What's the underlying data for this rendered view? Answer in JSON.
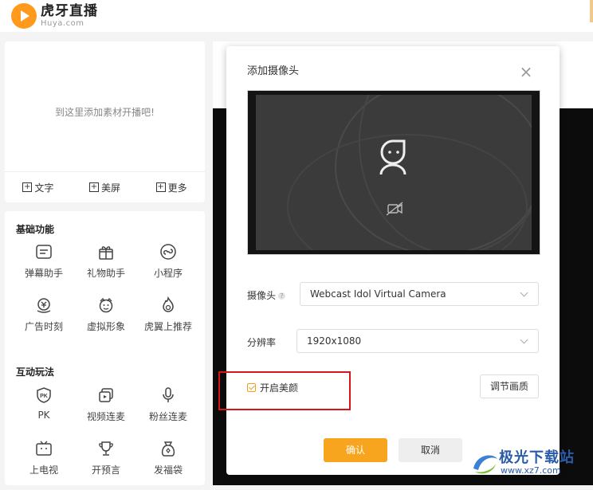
{
  "header": {
    "logo_cn": "虎牙直播",
    "logo_en": "Huya.com"
  },
  "sources": {
    "empty_text": "到这里添加素材开播吧!",
    "actions": [
      "文字",
      "美屏",
      "更多"
    ]
  },
  "basic": {
    "title": "基础功能",
    "items": [
      {
        "label": "弹幕助手",
        "icon": "danmaku-icon"
      },
      {
        "label": "礼物助手",
        "icon": "gift-icon"
      },
      {
        "label": "小程序",
        "icon": "mini-program-icon"
      },
      {
        "label": "广告时刻",
        "icon": "ad-money-icon"
      },
      {
        "label": "虚拟形象",
        "icon": "avatar-face-icon"
      },
      {
        "label": "虎翼上推荐",
        "icon": "flame-icon"
      }
    ]
  },
  "interactive": {
    "title": "互动玩法",
    "items": [
      {
        "label": "PK",
        "icon": "pk-shield-icon"
      },
      {
        "label": "视频连麦",
        "icon": "video-link-icon"
      },
      {
        "label": "粉丝连麦",
        "icon": "microphone-icon"
      },
      {
        "label": "上电视",
        "icon": "tv-icon"
      },
      {
        "label": "开预言",
        "icon": "trophy-icon"
      },
      {
        "label": "发福袋",
        "icon": "lucky-bag-icon"
      }
    ]
  },
  "dialog": {
    "title": "添加摄像头",
    "camera_label": "摄像头",
    "camera_value": "Webcast Idol Virtual Camera",
    "resolution_label": "分辨率",
    "resolution_value": "1920x1080",
    "beauty_label": "开启美颜",
    "beauty_checked": true,
    "adjust_label": "调节画质",
    "confirm_label": "确认",
    "cancel_label": "取消"
  },
  "watermark": {
    "name": "极光下载站",
    "url": "www.xz7.com"
  },
  "colors": {
    "accent": "#f7a51f",
    "highlight": "#d9151b"
  }
}
